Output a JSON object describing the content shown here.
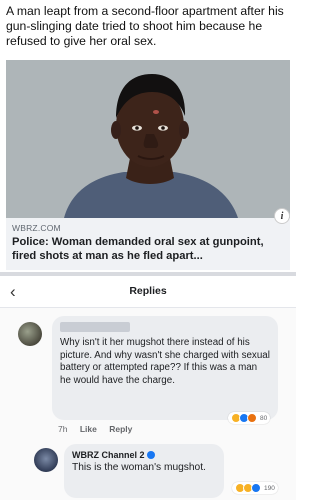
{
  "headline": {
    "text": "A man leapt from a second-floor apartment after his gun-slinging date tried to shoot him because he refused to give her oral sex."
  },
  "link_preview": {
    "source": "WBRZ.COM",
    "title": "Police: Woman demanded oral sex at gunpoint, fired shots at man as he fled apart...",
    "info_icon": "i"
  },
  "replies_header": {
    "back_icon": "‹",
    "title": "Replies"
  },
  "comment": {
    "text": "Why isn't it her mugshot there instead of his picture. And why wasn't she charged with sexual battery or attempted rape?? If this was a man he would have the charge.",
    "time": "7h",
    "like_label": "Like",
    "reply_label": "Reply",
    "reaction_count": "80"
  },
  "reply": {
    "author": "WBRZ Channel 2",
    "text": "This is the woman's mugshot.",
    "reaction_count": "190"
  },
  "colors": {
    "facebook_blue": "#1877f2",
    "bubble_bg": "#ebedf0",
    "card_bg": "#f0f2f5"
  }
}
